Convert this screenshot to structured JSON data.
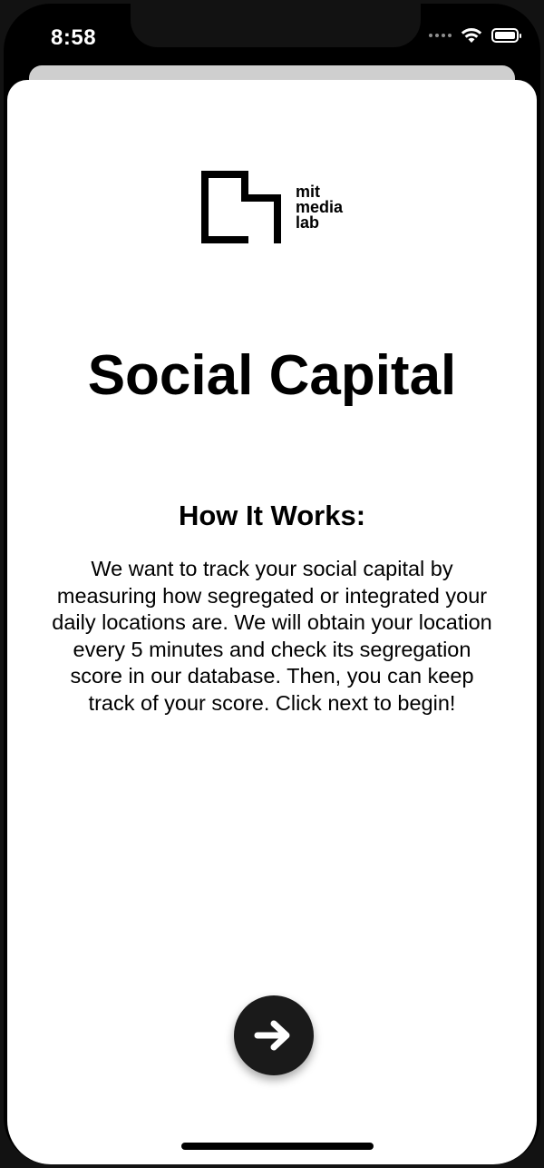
{
  "status_bar": {
    "time": "8:58",
    "signal_icon": "signal-dots-icon",
    "wifi_icon": "wifi-icon",
    "battery_icon": "battery-icon"
  },
  "header": {
    "logo_icon": "mit-media-lab-logo-icon",
    "logo_lines": [
      "mit",
      "media",
      "lab"
    ]
  },
  "main": {
    "title": "Social Capital",
    "subtitle": "How It Works:",
    "description": "We want to track your social capital by measuring how segregated or integrated your daily locations are. We will obtain your location every 5 minutes and check its segregation score in our database. Then, you can keep track of your score. Click next to begin!"
  },
  "actions": {
    "next_icon": "arrow-right-icon",
    "next_button_color": "#1a1a1a"
  }
}
